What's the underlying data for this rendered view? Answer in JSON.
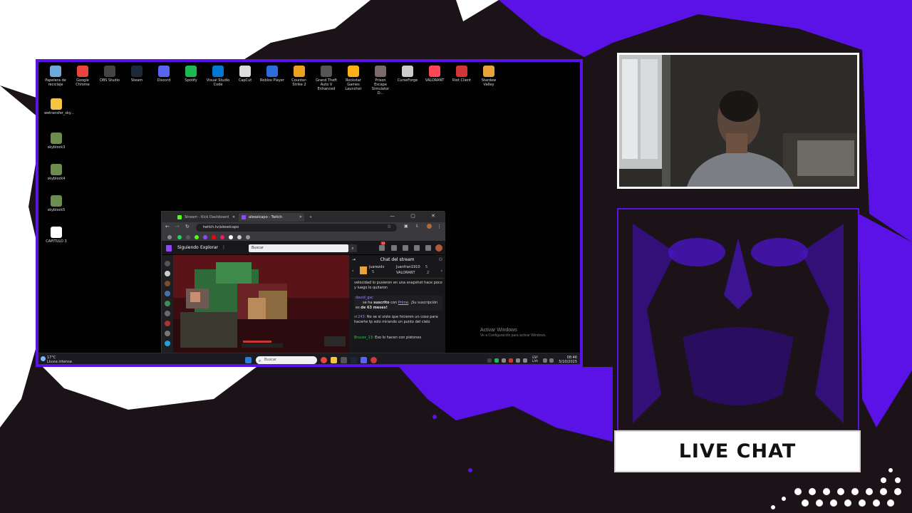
{
  "desktop": {
    "top_icons": [
      {
        "label": "Papelera de reciclaje",
        "icon": "recycle-bin-icon",
        "color": "#6fa8dc"
      },
      {
        "label": "Google Chrome",
        "icon": "chrome-icon",
        "color": "#e8453c"
      },
      {
        "label": "OBS Studio",
        "icon": "obs-icon",
        "color": "#444444"
      },
      {
        "label": "Steam",
        "icon": "steam-icon",
        "color": "#1b2838"
      },
      {
        "label": "Discord",
        "icon": "discord-icon",
        "color": "#5865f2"
      },
      {
        "label": "Spotify",
        "icon": "spotify-icon",
        "color": "#1db954"
      },
      {
        "label": "Visual Studio Code",
        "icon": "vscode-icon",
        "color": "#0078d4"
      },
      {
        "label": "CapCut",
        "icon": "capcut-icon",
        "color": "#dddddd"
      },
      {
        "label": "Roblox Player",
        "icon": "roblox-icon",
        "color": "#2d6cdf"
      },
      {
        "label": "Counter-Strike 2",
        "icon": "counter-strike-icon",
        "color": "#f0a020"
      },
      {
        "label": "Grand Theft Auto V Enhanced",
        "icon": "gta-icon",
        "color": "#555555"
      },
      {
        "label": "Rockstar Games Launcher",
        "icon": "rockstar-icon",
        "color": "#fcaf17"
      },
      {
        "label": "Prison Escape Simulator D...",
        "icon": "prison-escape-icon",
        "color": "#7a6a6a"
      },
      {
        "label": "CurseForge",
        "icon": "curseforge-icon",
        "color": "#cccccc"
      },
      {
        "label": "VALORANT",
        "icon": "valorant-icon",
        "color": "#ff4655"
      },
      {
        "label": "Riot Client",
        "icon": "riot-client-icon",
        "color": "#d13639"
      },
      {
        "label": "Stardew Valley",
        "icon": "stardew-valley-icon",
        "color": "#e8a33c"
      }
    ],
    "left_icons": [
      {
        "label": "wetransfer_sky...",
        "icon": "folder-icon",
        "color": "#f4c542"
      },
      {
        "label": "skyblock3",
        "icon": "image-file-icon",
        "color": "#6b8e4e"
      },
      {
        "label": "skyblock4",
        "icon": "image-file-icon",
        "color": "#6b8e4e"
      },
      {
        "label": "skyblock5",
        "icon": "image-file-icon",
        "color": "#6b8e4e"
      },
      {
        "label": "CAPITULO 3",
        "icon": "document-icon",
        "color": "#ffffff"
      }
    ],
    "activate_windows": {
      "title": "Activar Windows",
      "subtitle": "Ve a Configuración para activar Windows."
    }
  },
  "browser": {
    "tabs": [
      {
        "label": "Stream - Kick Dashboard",
        "color": "#53fc18"
      },
      {
        "label": "aleselcapo - Twitch",
        "color": "#9146ff"
      }
    ],
    "url": "twitch.tv/aleselcapo",
    "window_controls": "— ▢ ✕"
  },
  "twitch": {
    "nav_following": "Siguiendo",
    "nav_explore": "Explorar",
    "search_placeholder": "Buscar",
    "notification_count": "10",
    "chat_title": "Chat del stream",
    "gifters": [
      {
        "name": "juarezdv",
        "count": "5"
      },
      {
        "name": "Juanfran1910",
        "count": "5"
      },
      {
        "name": "VALORANT",
        "count": "2"
      }
    ],
    "messages": {
      "m1": "velocidad lo pusieron en una snapshot hace poco y luego lo quitaron",
      "m2_user": "david_gsc",
      "m2_pre": "se ha ",
      "m2_bold": "suscrito",
      "m2_mid": " con ",
      "m2_link": "Prime",
      "m2_post": ". ¡Su suscripción es ",
      "m2_months": "de 63 meses!",
      "m3_user": "or243:",
      "m3_text": " No se si viste que hicieron un coso para hacerte tp solo mirando un punto del cielo",
      "m4_user": "Bruuss_13:",
      "m4_text": " Eso lo hacen con pistones"
    }
  },
  "taskbar": {
    "weather_temp": "17°C",
    "weather_desc": "Lluvia intensa",
    "search_placeholder": "Buscar",
    "lang_top": "ESP",
    "lang_bottom": "LAA",
    "time": "08:46",
    "date": "5/10/2025"
  },
  "overlay": {
    "accent": "#5b12e6",
    "live_chat_label": "LIVE CHAT"
  }
}
